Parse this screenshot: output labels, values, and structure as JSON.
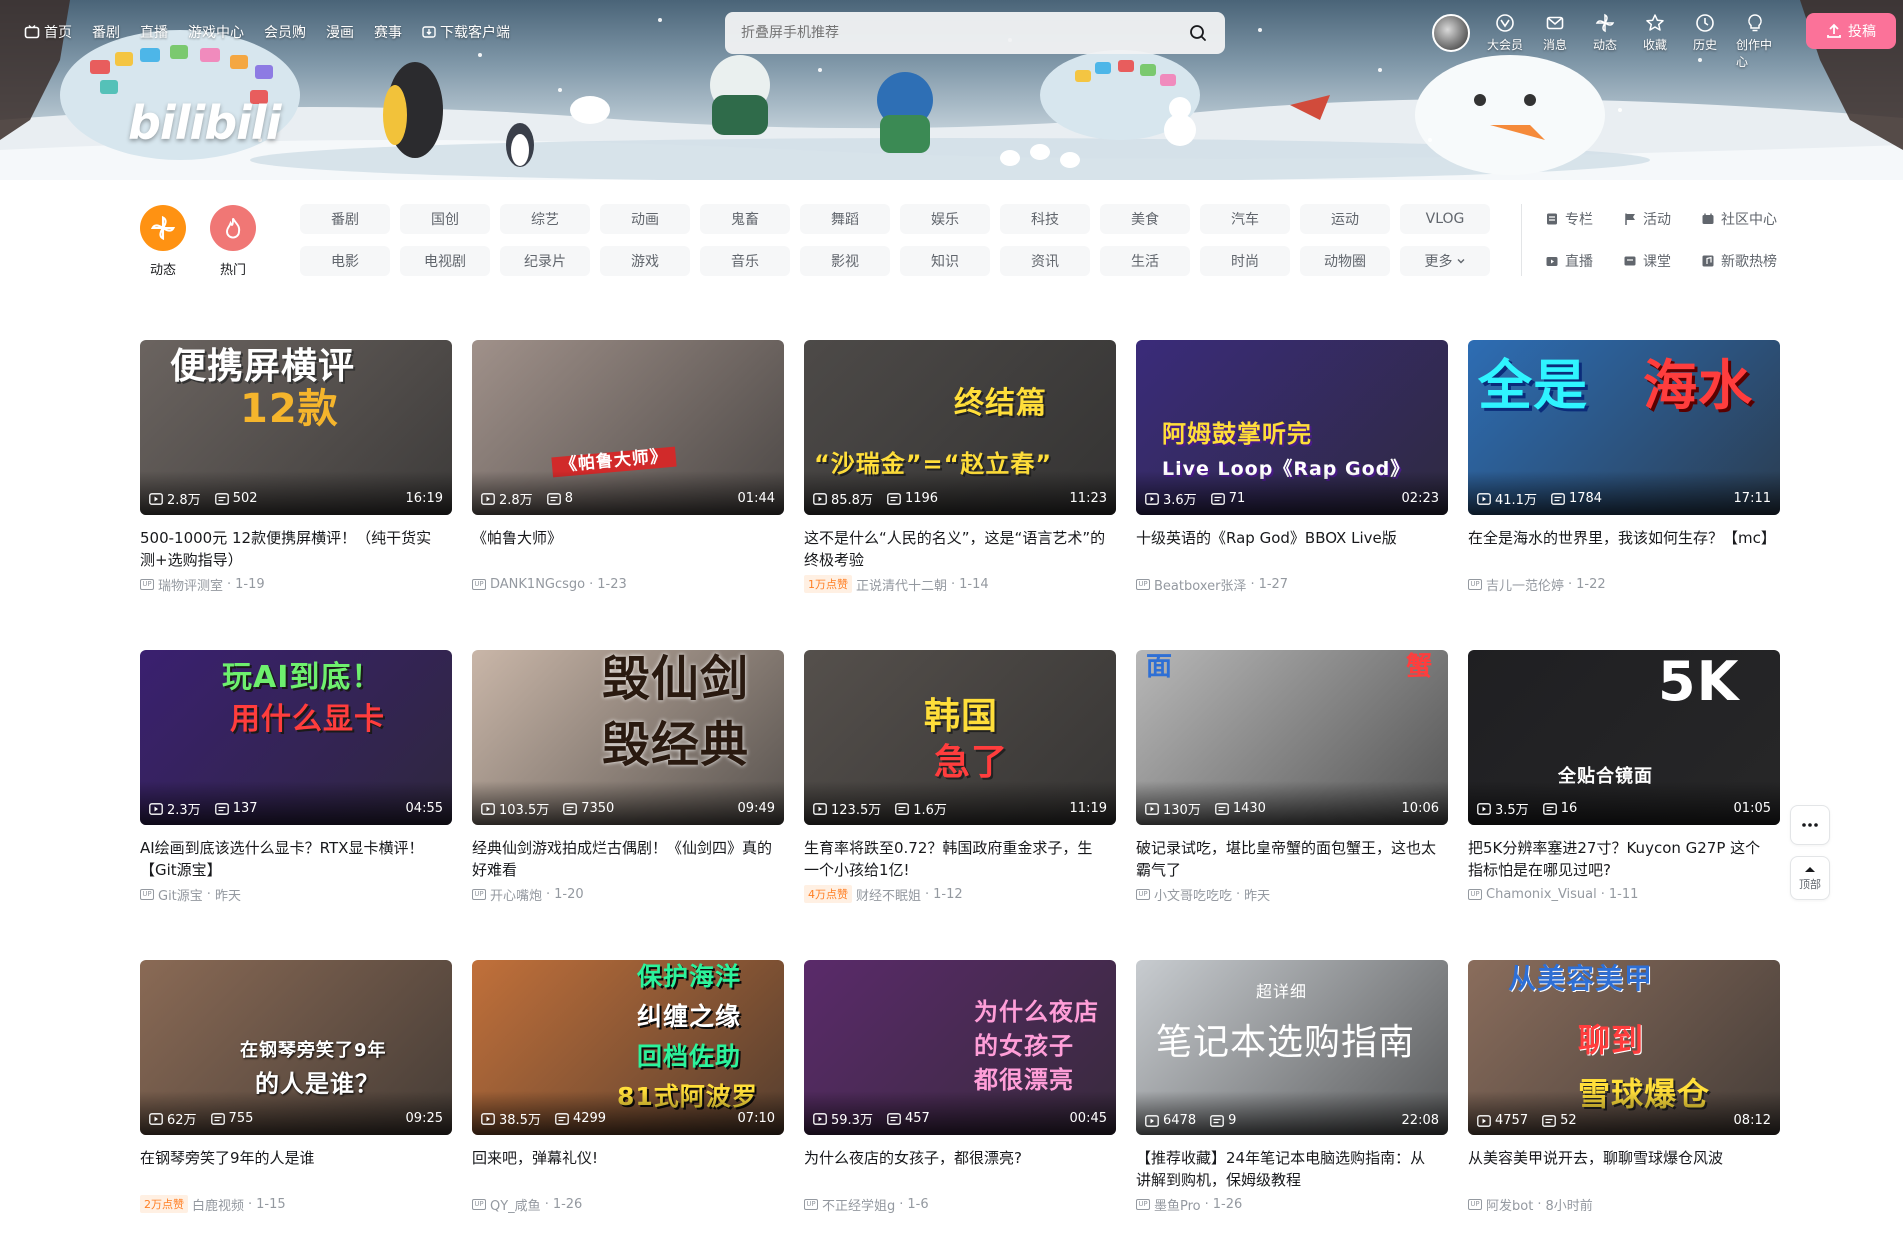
{
  "topnav": {
    "items": [
      "首页",
      "番剧",
      "直播",
      "游戏中心",
      "会员购",
      "漫画",
      "赛事",
      "下载客户端"
    ]
  },
  "logo": {
    "text": "bilibili"
  },
  "search": {
    "placeholder": "折叠屏手机推荐"
  },
  "rightnav": {
    "items": [
      "大会员",
      "消息",
      "动态",
      "收藏",
      "历史",
      "创作中心"
    ],
    "upload_label": "投稿"
  },
  "channels": {
    "round": [
      {
        "label": "动态",
        "color": "#ff9212"
      },
      {
        "label": "热门",
        "color": "#f07775"
      }
    ],
    "row1": [
      "番剧",
      "国创",
      "综艺",
      "动画",
      "鬼畜",
      "舞蹈",
      "娱乐",
      "科技",
      "美食",
      "汽车",
      "运动",
      "VLOG"
    ],
    "row2": [
      "电影",
      "电视剧",
      "纪录片",
      "游戏",
      "音乐",
      "影视",
      "知识",
      "资讯",
      "生活",
      "时尚",
      "动物圈",
      "更多"
    ],
    "side": [
      "专栏",
      "活动",
      "社区中心",
      "直播",
      "课堂",
      "新歌热榜"
    ]
  },
  "videos": [
    {
      "title": "500-1000元 12款便携屏横评！（纯干货实测+选购指导）",
      "author": "瑞物评测室",
      "date": "1-19",
      "views": "2.8万",
      "danmaku": "502",
      "duration": "16:19",
      "badge": "",
      "art": [
        "便携屏横评",
        "12款"
      ],
      "bg": "#6b6460"
    },
    {
      "title": "《帕鲁大师》",
      "author": "DANK1NGcsgo",
      "date": "1-23",
      "views": "2.8万",
      "danmaku": "8",
      "duration": "01:44",
      "badge": "",
      "art": [
        "《帕鲁大师》"
      ],
      "bg": "#a0918a"
    },
    {
      "title": "这不是什么“人民的名义”，这是“语言艺术”的终极考验",
      "author": "正说清代十二朝",
      "date": "1-14",
      "views": "85.8万",
      "danmaku": "1196",
      "duration": "11:23",
      "badge": "1万点赞",
      "art": [
        "终结篇",
        "“沙瑞金”=“赵立春”"
      ],
      "bg": "#4d4a48"
    },
    {
      "title": "十级英语的《Rap God》BBOX Live版",
      "author": "Beatboxer张泽",
      "date": "1-27",
      "views": "3.6万",
      "danmaku": "71",
      "duration": "02:23",
      "badge": "",
      "art": [
        "阿姆鼓掌听完",
        "Live Loop《Rap God》"
      ],
      "bg": "#3a2b7a"
    },
    {
      "title": "在全是海水的世界里，我该如何生存？【mc】",
      "author": "吉儿一范伦婷",
      "date": "1-22",
      "views": "41.1万",
      "danmaku": "1784",
      "duration": "17:11",
      "badge": "",
      "art": [
        "全是",
        "海水"
      ],
      "bg": "#2d6db4"
    },
    {
      "title": "AI绘画到底该选什么显卡？RTX显卡横评！【Git源宝】",
      "author": "Git源宝",
      "date": "昨天",
      "views": "2.3万",
      "danmaku": "137",
      "duration": "04:55",
      "badge": "",
      "art": [
        "玩AI到底！",
        "用什么显卡"
      ],
      "bg": "#3a2070"
    },
    {
      "title": "经典仙剑游戏拍成烂古偶剧！《仙剑四》真的好难看",
      "author": "开心嘴炮",
      "date": "1-20",
      "views": "103.5万",
      "danmaku": "7350",
      "duration": "09:49",
      "badge": "",
      "art": [
        "毁仙剑",
        "毁经典"
      ],
      "bg": "#c9b6a8"
    },
    {
      "title": "生育率将跌至0.72？韩国政府重金求子，生一个小孩给1亿!",
      "author": "财经不眠姐",
      "date": "1-12",
      "views": "123.5万",
      "danmaku": "1.6万",
      "duration": "11:19",
      "badge": "4万点赞",
      "art": [
        "韩国",
        "急了"
      ],
      "bg": "#55504c"
    },
    {
      "title": "破记录试吃，堪比皇帝蟹的面包蟹王，这也太霸气了",
      "author": "小文哥吃吃吃",
      "date": "昨天",
      "views": "130万",
      "danmaku": "1430",
      "duration": "10:06",
      "badge": "",
      "art": [
        "面",
        "蟹"
      ],
      "bg": "#b8b8b8"
    },
    {
      "title": "把5K分辨率塞进27寸？Kuycon G27P 这个指标怕是在哪见过吧?",
      "author": "Chamonix_Visual",
      "date": "1-11",
      "views": "3.5万",
      "danmaku": "16",
      "duration": "01:05",
      "badge": "",
      "art": [
        "5K",
        "全贴合镜面"
      ],
      "bg": "#1f1f22"
    },
    {
      "title": "在钢琴旁笑了9年的人是谁",
      "author": "白鹿视频",
      "date": "1-15",
      "views": "62万",
      "danmaku": "755",
      "duration": "09:25",
      "badge": "2万点赞",
      "art": [
        "在钢琴旁笑了9年",
        "的人是谁？"
      ],
      "bg": "#8a6a55"
    },
    {
      "title": "回来吧，弹幕礼仪!",
      "author": "QY_咸鱼",
      "date": "1-26",
      "views": "38.5万",
      "danmaku": "4299",
      "duration": "07:10",
      "badge": "",
      "art": [
        "保护海洋",
        "纠缠之缘",
        "回档佐助",
        "81式阿波罗"
      ],
      "bg": "#c1703a"
    },
    {
      "title": "为什么夜店的女孩子，都很漂亮?",
      "author": "不正经学姐g",
      "date": "1-6",
      "views": "59.3万",
      "danmaku": "457",
      "duration": "00:45",
      "badge": "",
      "art": [
        "为什么夜店",
        "的女孩子",
        "都很漂亮"
      ],
      "bg": "#5a2a6a"
    },
    {
      "title": "【推荐收藏】24年笔记本电脑选购指南：从讲解到购机，保姆级教程",
      "author": "墨鱼Pro",
      "date": "1-26",
      "views": "6478",
      "danmaku": "9",
      "duration": "22:08",
      "badge": "",
      "art": [
        "超详细",
        "笔记本选购指南"
      ],
      "bg": "#c8ccd0"
    },
    {
      "title": "从美容美甲说开去，聊聊雪球爆仓风波",
      "author": "阿发bot",
      "date": "8小时前",
      "views": "4757",
      "danmaku": "52",
      "duration": "08:12",
      "badge": "",
      "art": [
        "从美容美甲",
        "聊到",
        "雪球爆仓"
      ],
      "bg": "#8a6d5c"
    }
  ],
  "floating": {
    "top_label": "顶部"
  },
  "colors": {
    "accent": "#fb7299",
    "brand_blue": "#00aeec"
  }
}
